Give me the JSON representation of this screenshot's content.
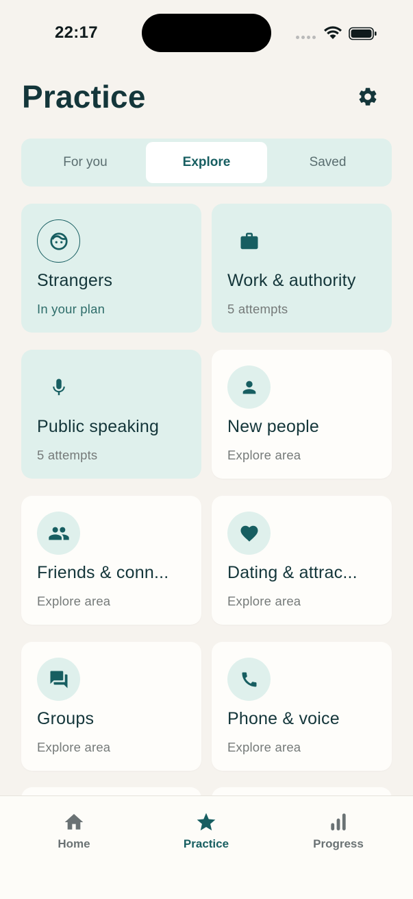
{
  "status_bar": {
    "time": "22:17"
  },
  "header": {
    "title": "Practice",
    "settings_icon": "gear-icon"
  },
  "tabs": [
    {
      "label": "For you",
      "active": false
    },
    {
      "label": "Explore",
      "active": true
    },
    {
      "label": "Saved",
      "active": false
    }
  ],
  "cards": [
    {
      "title": "Strangers",
      "subtitle": "In your plan",
      "icon": "face-icon",
      "style": "tinted"
    },
    {
      "title": "Work & authority",
      "subtitle": "5 attempts",
      "icon": "briefcase-icon",
      "style": "tinted"
    },
    {
      "title": "Public speaking",
      "subtitle": "5 attempts",
      "icon": "microphone-icon",
      "style": "tinted"
    },
    {
      "title": "New people",
      "subtitle": "Explore area",
      "icon": "person-icon",
      "style": "plain"
    },
    {
      "title": "Friends & conn...",
      "subtitle": "Explore area",
      "icon": "people-icon",
      "style": "plain"
    },
    {
      "title": "Dating & attrac...",
      "subtitle": "Explore area",
      "icon": "heart-icon",
      "style": "plain"
    },
    {
      "title": "Groups",
      "subtitle": "Explore area",
      "icon": "chat-icon",
      "style": "plain"
    },
    {
      "title": "Phone & voice",
      "subtitle": "Explore area",
      "icon": "phone-icon",
      "style": "plain"
    }
  ],
  "bottom_nav": [
    {
      "label": "Home",
      "icon": "home-icon",
      "active": false
    },
    {
      "label": "Practice",
      "icon": "star-icon",
      "active": true
    },
    {
      "label": "Progress",
      "icon": "bar-chart-icon",
      "active": false
    }
  ],
  "colors": {
    "background": "#f6f3ee",
    "accent": "#175e61",
    "tint": "#dff0ec",
    "card": "#fefdfa",
    "text": "#14363a",
    "muted": "#757a79"
  }
}
